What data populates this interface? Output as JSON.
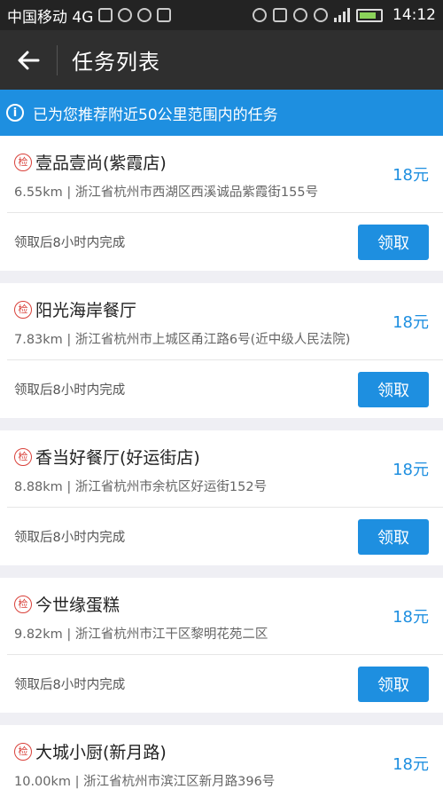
{
  "status_bar": {
    "carrier": "中国移动 4G",
    "time": "14:12"
  },
  "header": {
    "title": "任务列表"
  },
  "notice": {
    "text": "已为您推荐附近50公里范围内的任务"
  },
  "tasks": [
    {
      "badge": "检",
      "name": "壹品壹尚(紫霞店)",
      "address": "6.55km | 浙江省杭州市西湖区西溪诚品紫霞街155号",
      "price": "18元",
      "deadline": "领取后8小时内完成",
      "button": "领取"
    },
    {
      "badge": "检",
      "name": "阳光海岸餐厅",
      "address": "7.83km | 浙江省杭州市上城区甬江路6号(近中级人民法院)",
      "price": "18元",
      "deadline": "领取后8小时内完成",
      "button": "领取"
    },
    {
      "badge": "检",
      "name": "香当好餐厅(好运街店)",
      "address": "8.88km | 浙江省杭州市余杭区好运街152号",
      "price": "18元",
      "deadline": "领取后8小时内完成",
      "button": "领取"
    },
    {
      "badge": "检",
      "name": "今世缘蛋糕",
      "address": "9.82km | 浙江省杭州市江干区黎明花苑二区",
      "price": "18元",
      "deadline": "领取后8小时内完成",
      "button": "领取"
    },
    {
      "badge": "检",
      "name": "大城小厨(新月路)",
      "address": "10.00km | 浙江省杭州市滨江区新月路396号",
      "price": "18元",
      "deadline": "",
      "button": ""
    }
  ]
}
